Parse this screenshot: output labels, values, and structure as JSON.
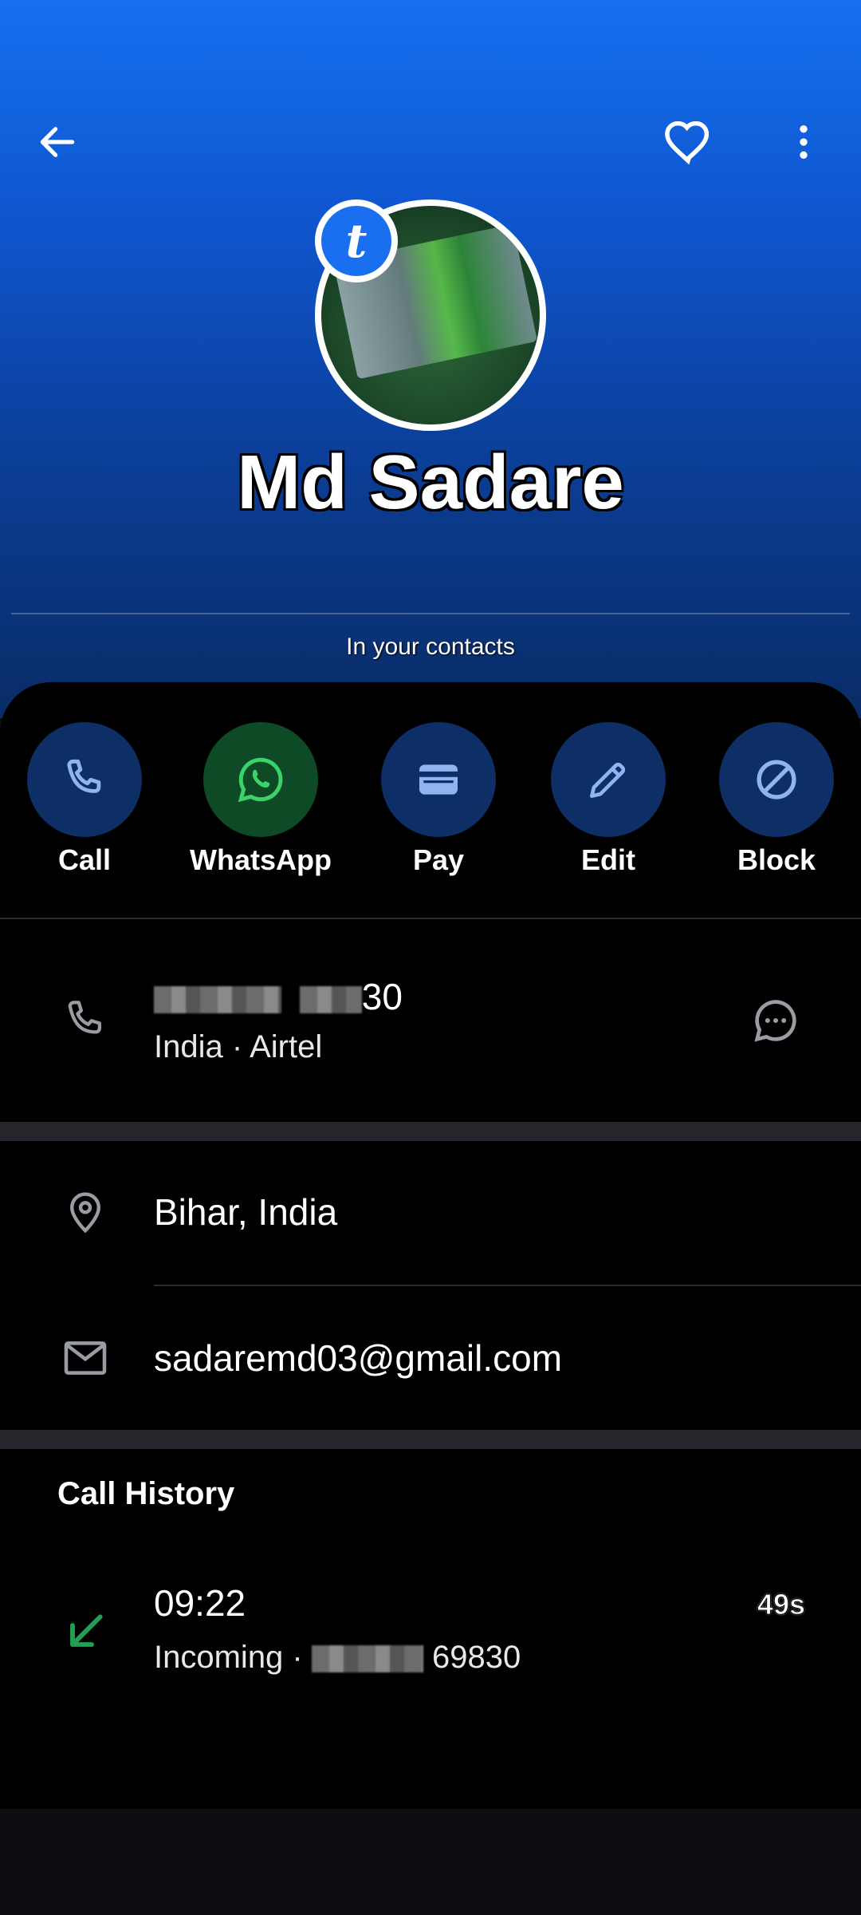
{
  "header": {
    "contact_name": "Md Sadare",
    "badge_letter": "t",
    "contacts_label": "In your contacts",
    "icons": [
      "arrow-left-icon",
      "heart-icon",
      "more-vert-icon"
    ]
  },
  "actions": [
    {
      "label": "Call",
      "icon": "phone-icon"
    },
    {
      "label": "WhatsApp",
      "icon": "whatsapp-icon"
    },
    {
      "label": "Pay",
      "icon": "wallet-icon"
    },
    {
      "label": "Edit",
      "icon": "pencil-icon"
    },
    {
      "label": "Block",
      "icon": "block-icon"
    }
  ],
  "phone": {
    "number_tail": "30",
    "carrier": "India · Airtel"
  },
  "location": "Bihar, India",
  "email": "sadaremd03@gmail.com",
  "call_history": {
    "title": "Call History",
    "entries": [
      {
        "time": "09:22",
        "type": "Incoming · ",
        "number_tail": "69830",
        "duration": "49s"
      }
    ]
  },
  "colors": {
    "header_top": "#1670f0",
    "action_circle": "#0d2f66",
    "whatsapp_circle": "#0e4a26",
    "incoming_arrow": "#1fa052"
  }
}
